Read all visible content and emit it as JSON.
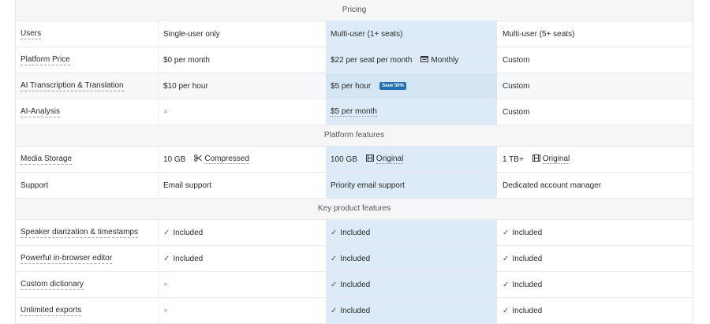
{
  "sections": {
    "pricing": "Pricing",
    "platform": "Platform features",
    "key": "Key product features"
  },
  "rows": {
    "users": {
      "label": "Users",
      "a": "Single-user only",
      "b": "Multi-user (1+ seats)",
      "c": "Multi-user (5+ seats)"
    },
    "price": {
      "label": "Platform Price",
      "a": "$0 per month",
      "b": "$22 per seat per month",
      "b_extra": "Monthly",
      "c": "Custom"
    },
    "ai_trans": {
      "label": "AI Transcription & Translation",
      "a": "$10 per hour",
      "b": "$5 per hour",
      "b_badge": "Save 50%",
      "c": "Custom"
    },
    "ai_analysis": {
      "label": "AI-Analysis",
      "a": "×",
      "b": "$5 per month",
      "c": "Custom"
    },
    "storage": {
      "label": "Media Storage",
      "a": "10 GB",
      "a_extra": "Compressed",
      "b": "100 GB",
      "b_extra": "Original",
      "c": "1 TB+",
      "c_extra": "Original"
    },
    "support": {
      "label": "Support",
      "a": "Email support",
      "b": "Priority email support",
      "c": "Dedicated account manager"
    },
    "diarization": {
      "label": "Speaker diarization & timestamps",
      "a": "Included",
      "b": "Included",
      "c": "Included"
    },
    "editor": {
      "label": "Powerful in-browser editor",
      "a": "Included",
      "b": "Included",
      "c": "Included"
    },
    "dictionary": {
      "label": "Custom dictionary",
      "a": "×",
      "b": "Included",
      "c": "Included"
    },
    "exports": {
      "label": "Unlimited exports",
      "a": "×",
      "b": "Included",
      "c": "Included"
    }
  },
  "icons": {
    "check": "✓",
    "cross": "×",
    "calendar": "calendar-icon",
    "scissors": "scissors-icon",
    "film": "film-icon"
  },
  "colors": {
    "highlight_column": "#dcebf7",
    "badge": "#1f6fb2"
  }
}
